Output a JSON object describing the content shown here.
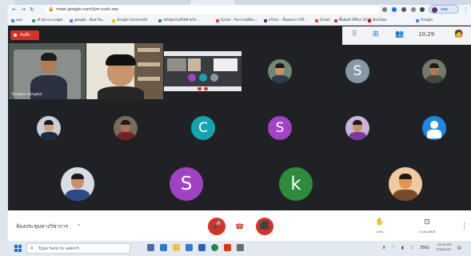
{
  "browser": {
    "url": "meet.google.com/kjm-ourk-nec",
    "profile_label": "หยุดชั่วคราว",
    "bookmarks": [
      {
        "label": "แอป",
        "color": "#4285f4"
      },
      {
        "label": "เข้าสู่ระบบ Login",
        "color": "#34a853"
      },
      {
        "label": "google - ค้นหาใน...",
        "color": "#4285f4"
      },
      {
        "label": "Google Università",
        "color": "#fbbc05"
      },
      {
        "label": "หลักสูตรไลฟ์ได้สำหรับ...",
        "color": "#0f9d58"
      },
      {
        "label": "Gmail - กิจกรรมที่ต้อง...",
        "color": "#ea4335"
      },
      {
        "label": "eTrain - ขั้นตอนการใช้...",
        "color": "#6a1b9a"
      },
      {
        "label": "Gmail",
        "color": "#ea4335"
      },
      {
        "label": "ซื้อทันที Office 2019...",
        "color": "#d83b01"
      },
      {
        "label": "YouTube",
        "color": "#ff0000"
      },
      {
        "label": "Google",
        "color": "#4285f4"
      }
    ]
  },
  "meet": {
    "recording_label": "บันทึก",
    "clock": "10:29",
    "meeting_name": "ห้องประชุมทางวิชาการ",
    "featured_name": "Tanapon Songkot"
  },
  "participants": [
    {
      "kind": "photo",
      "bg": "#6f8a73",
      "skin": "#c98f6b",
      "shirt": "#2e3a4e"
    },
    {
      "kind": "letter",
      "letter": "S",
      "bg": "#8899a6"
    },
    {
      "kind": "photo",
      "bg": "#6f7a6a",
      "skin": "#b07a56",
      "shirt": "#3f4b3a"
    },
    {
      "kind": "photo",
      "bg": "#c9cfd4",
      "skin": "#d0a07c",
      "shirt": "#1f2a44"
    },
    {
      "kind": "photo",
      "bg": "#7a6a5c",
      "skin": "#a8725a",
      "shirt": "#7a1f1f"
    },
    {
      "kind": "letter",
      "letter": "C",
      "bg": "#12a4af"
    },
    {
      "kind": "letter",
      "letter": "S",
      "bg": "#a142c4"
    },
    {
      "kind": "photo",
      "bg": "#c9b3d9",
      "skin": "#c98f6b",
      "shirt": "#7a3aa0"
    },
    {
      "kind": "person-icon",
      "bg": "#1e88e5"
    },
    {
      "kind": "photo",
      "bg": "#d8dde2",
      "skin": "#c98f6b",
      "shirt": "#2a4a8a"
    },
    {
      "kind": "letter",
      "letter": "S",
      "bg": "#a142c4"
    },
    {
      "kind": "letter",
      "letter": "k",
      "bg": "#2e8b3a"
    },
    {
      "kind": "photo",
      "bg": "#efc9a0",
      "skin": "#e3954f",
      "shirt": "#7a4a2a"
    }
  ],
  "controls": {
    "hand_label": "ยกมือ",
    "present_label": "นำเสนอทันที"
  },
  "taskbar": {
    "search_placeholder": "Type here to search",
    "time": "10:29 PM",
    "date": "7/18/2021"
  }
}
